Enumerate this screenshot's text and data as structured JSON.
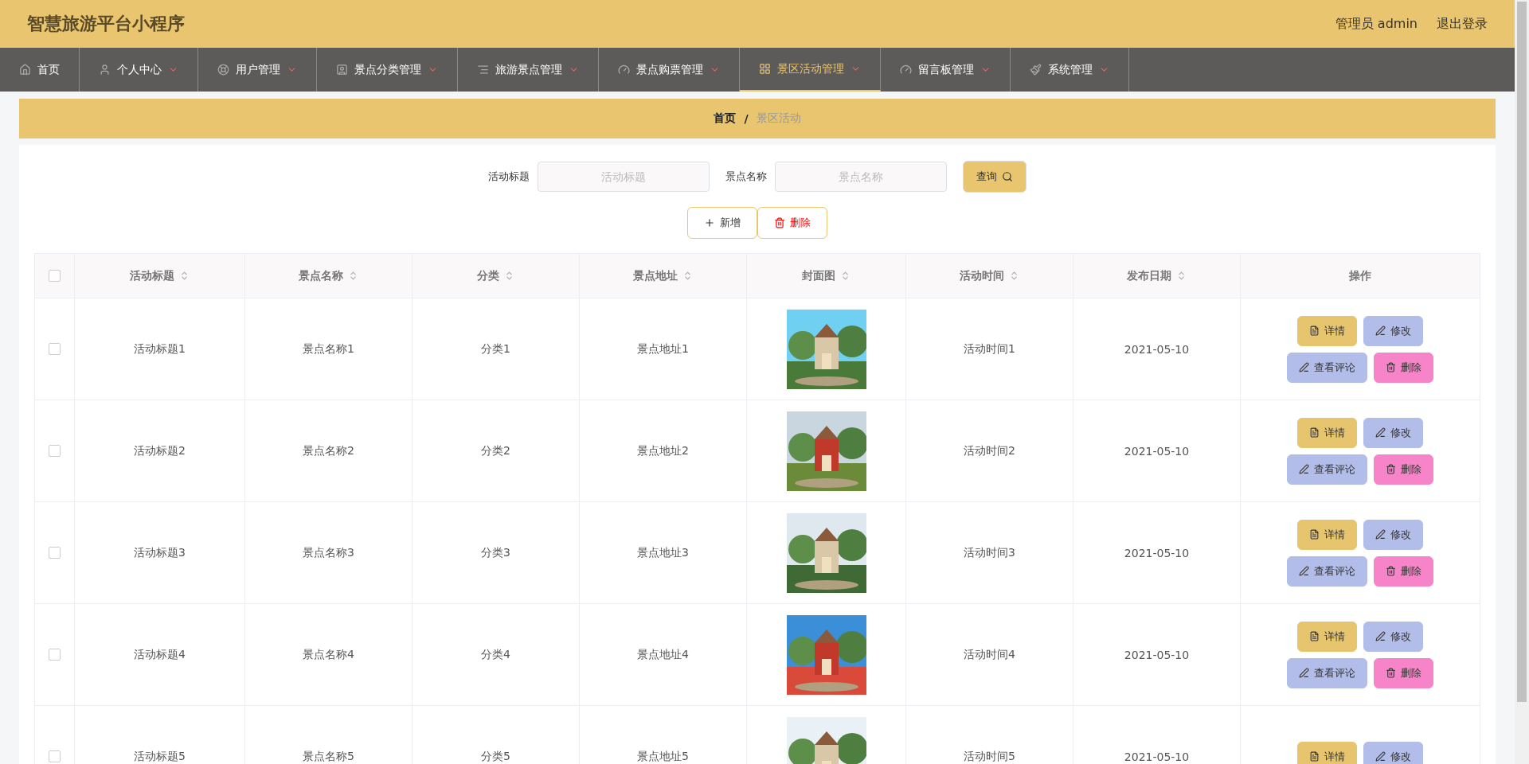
{
  "header": {
    "title": "智慧旅游平台小程序",
    "user": "管理员 admin",
    "logout": "退出登录"
  },
  "nav": [
    {
      "label": "首页",
      "selected": false,
      "dropdown": false
    },
    {
      "label": "个人中心",
      "selected": false,
      "dropdown": true
    },
    {
      "label": "用户管理",
      "selected": false,
      "dropdown": true
    },
    {
      "label": "景点分类管理",
      "selected": false,
      "dropdown": true
    },
    {
      "label": "旅游景点管理",
      "selected": false,
      "dropdown": true
    },
    {
      "label": "景点购票管理",
      "selected": false,
      "dropdown": true
    },
    {
      "label": "景区活动管理",
      "selected": true,
      "dropdown": true
    },
    {
      "label": "留言板管理",
      "selected": false,
      "dropdown": true
    },
    {
      "label": "系统管理",
      "selected": false,
      "dropdown": true
    }
  ],
  "breadcrumb": {
    "home": "首页",
    "separator": "/",
    "current": "景区活动"
  },
  "search": {
    "fields": [
      {
        "label": "活动标题",
        "placeholder": "活动标题"
      },
      {
        "label": "景点名称",
        "placeholder": "景点名称"
      }
    ],
    "button": "查询"
  },
  "actions": {
    "add": "新增",
    "delete": "删除"
  },
  "table": {
    "select_all_checked": false,
    "columns": [
      {
        "label": "活动标题",
        "sortable": true
      },
      {
        "label": "景点名称",
        "sortable": true
      },
      {
        "label": "分类",
        "sortable": true
      },
      {
        "label": "景点地址",
        "sortable": true
      },
      {
        "label": "封面图",
        "sortable": true
      },
      {
        "label": "活动时间",
        "sortable": true
      },
      {
        "label": "发布日期",
        "sortable": true
      },
      {
        "label": "操作",
        "sortable": false
      }
    ],
    "rows": [
      {
        "checked": false,
        "title": "活动标题1",
        "name": "景点名称1",
        "category": "分类1",
        "address": "景点地址1",
        "cover": {
          "kind": "picture"
        },
        "time": "活动时间1",
        "date": "2021-05-10",
        "buttons": [
          {
            "kind": "detail",
            "label": "详情"
          },
          {
            "kind": "edit",
            "label": "修改"
          },
          {
            "kind": "comments",
            "label": "查看评论"
          },
          {
            "kind": "delete",
            "label": "删除"
          }
        ]
      },
      {
        "checked": false,
        "title": "活动标题2",
        "name": "景点名称2",
        "category": "分类2",
        "address": "景点地址2",
        "cover": {
          "kind": "picture"
        },
        "time": "活动时间2",
        "date": "2021-05-10",
        "buttons": [
          {
            "kind": "detail",
            "label": "详情"
          },
          {
            "kind": "edit",
            "label": "修改"
          },
          {
            "kind": "comments",
            "label": "查看评论"
          },
          {
            "kind": "delete",
            "label": "删除"
          }
        ]
      },
      {
        "checked": false,
        "title": "活动标题3",
        "name": "景点名称3",
        "category": "分类3",
        "address": "景点地址3",
        "cover": {
          "kind": "picture"
        },
        "time": "活动时间3",
        "date": "2021-05-10",
        "buttons": [
          {
            "kind": "detail",
            "label": "详情"
          },
          {
            "kind": "edit",
            "label": "修改"
          },
          {
            "kind": "comments",
            "label": "查看评论"
          },
          {
            "kind": "delete",
            "label": "删除"
          }
        ]
      },
      {
        "checked": false,
        "title": "活动标题4",
        "name": "景点名称4",
        "category": "分类4",
        "address": "景点地址4",
        "cover": {
          "kind": "picture"
        },
        "time": "活动时间4",
        "date": "2021-05-10",
        "buttons": [
          {
            "kind": "detail",
            "label": "详情"
          },
          {
            "kind": "edit",
            "label": "修改"
          },
          {
            "kind": "comments",
            "label": "查看评论"
          },
          {
            "kind": "delete",
            "label": "删除"
          }
        ]
      },
      {
        "checked": false,
        "title": "活动标题5",
        "name": "景点名称5",
        "category": "分类5",
        "address": "景点地址5",
        "cover": {
          "kind": "picture"
        },
        "time": "活动时间5",
        "date": "2021-05-10",
        "buttons": [
          {
            "kind": "detail",
            "label": "详情"
          },
          {
            "kind": "edit",
            "label": "修改"
          }
        ]
      }
    ]
  }
}
